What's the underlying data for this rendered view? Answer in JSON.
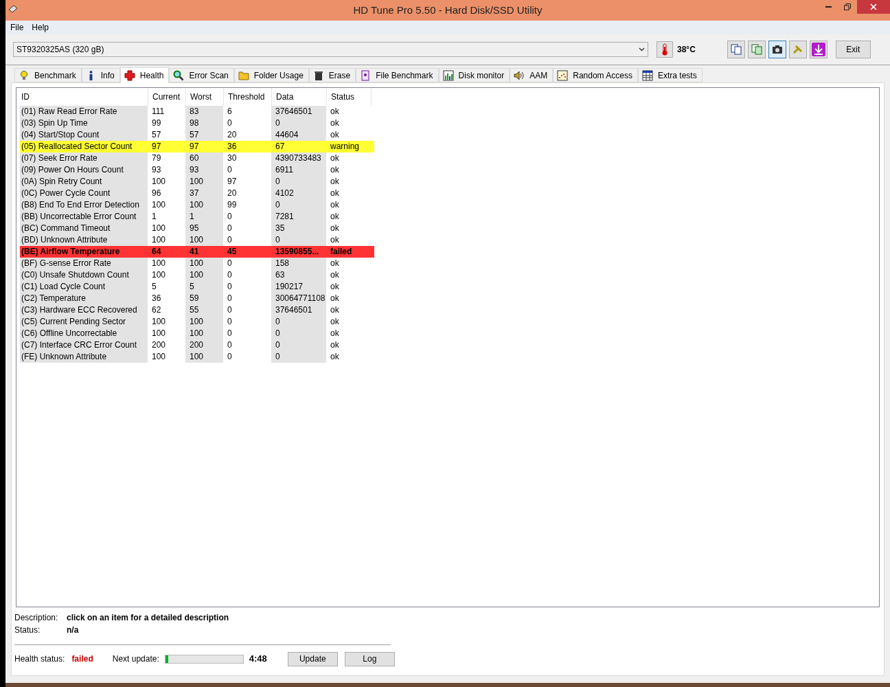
{
  "window": {
    "title": "HD Tune Pro 5.50 - Hard Disk/SSD Utility"
  },
  "menu": [
    "File",
    "Help"
  ],
  "drive_select": {
    "value": "ST9320325AS (320 gB)"
  },
  "temperature": "38°C",
  "toolbar_buttons": [
    {
      "kind": "copy",
      "selected": false
    },
    {
      "kind": "copy-info",
      "selected": false
    },
    {
      "kind": "camera",
      "selected": true
    },
    {
      "kind": "settings",
      "selected": false
    },
    {
      "kind": "save",
      "selected": false
    }
  ],
  "exit_button": "Exit",
  "tabs": [
    {
      "label": "Benchmark",
      "kind": "bulb",
      "selected": false
    },
    {
      "label": "Info",
      "kind": "info",
      "selected": false
    },
    {
      "label": "Health",
      "kind": "cross",
      "selected": true
    },
    {
      "label": "Error Scan",
      "kind": "magnifier",
      "selected": false
    },
    {
      "label": "Folder Usage",
      "kind": "folder",
      "selected": false
    },
    {
      "label": "Erase",
      "kind": "bin",
      "selected": false
    },
    {
      "label": "File Benchmark",
      "kind": "file",
      "selected": false
    },
    {
      "label": "Disk monitor",
      "kind": "chart",
      "selected": false
    },
    {
      "label": "AAM",
      "kind": "speaker",
      "selected": false
    },
    {
      "label": "Random Access",
      "kind": "dots",
      "selected": false
    },
    {
      "label": "Extra tests",
      "kind": "grid",
      "selected": false
    }
  ],
  "table": {
    "columns": [
      "ID",
      "Current",
      "Worst",
      "Threshold",
      "Data",
      "Status"
    ],
    "rows": [
      {
        "cells": [
          "(01) Raw Read Error Rate",
          "111",
          "83",
          "6",
          "37646501",
          "ok"
        ],
        "kind": "ok"
      },
      {
        "cells": [
          "(03) Spin Up Time",
          "99",
          "98",
          "0",
          "0",
          "ok"
        ],
        "kind": "ok"
      },
      {
        "cells": [
          "(04) Start/Stop Count",
          "57",
          "57",
          "20",
          "44604",
          "ok"
        ],
        "kind": "ok"
      },
      {
        "cells": [
          "(05) Reallocated Sector Count",
          "97",
          "97",
          "36",
          "67",
          "warning"
        ],
        "kind": "warning"
      },
      {
        "cells": [
          "(07) Seek Error Rate",
          "79",
          "60",
          "30",
          "4390733483",
          "ok"
        ],
        "kind": "ok"
      },
      {
        "cells": [
          "(09) Power On Hours Count",
          "93",
          "93",
          "0",
          "6911",
          "ok"
        ],
        "kind": "ok"
      },
      {
        "cells": [
          "(0A) Spin Retry Count",
          "100",
          "100",
          "97",
          "0",
          "ok"
        ],
        "kind": "ok"
      },
      {
        "cells": [
          "(0C) Power Cycle Count",
          "96",
          "37",
          "20",
          "4102",
          "ok"
        ],
        "kind": "ok"
      },
      {
        "cells": [
          "(B8) End To End Error Detection",
          "100",
          "100",
          "99",
          "0",
          "ok"
        ],
        "kind": "ok"
      },
      {
        "cells": [
          "(BB) Uncorrectable Error Count",
          "1",
          "1",
          "0",
          "7281",
          "ok"
        ],
        "kind": "ok"
      },
      {
        "cells": [
          "(BC) Command Timeout",
          "100",
          "95",
          "0",
          "35",
          "ok"
        ],
        "kind": "ok"
      },
      {
        "cells": [
          "(BD) Unknown Attribute",
          "100",
          "100",
          "0",
          "0",
          "ok"
        ],
        "kind": "ok"
      },
      {
        "cells": [
          "(BE) Airflow Temperature",
          "64",
          "41",
          "45",
          "13590855...",
          "failed"
        ],
        "kind": "failed"
      },
      {
        "cells": [
          "(BF) G-sense Error Rate",
          "100",
          "100",
          "0",
          "158",
          "ok"
        ],
        "kind": "ok"
      },
      {
        "cells": [
          "(C0) Unsafe Shutdown Count",
          "100",
          "100",
          "0",
          "63",
          "ok"
        ],
        "kind": "ok"
      },
      {
        "cells": [
          "(C1) Load Cycle Count",
          "5",
          "5",
          "0",
          "190217",
          "ok"
        ],
        "kind": "ok"
      },
      {
        "cells": [
          "(C2) Temperature",
          "36",
          "59",
          "0",
          "30064771108",
          "ok"
        ],
        "kind": "ok"
      },
      {
        "cells": [
          "(C3) Hardware ECC Recovered",
          "62",
          "55",
          "0",
          "37646501",
          "ok"
        ],
        "kind": "ok"
      },
      {
        "cells": [
          "(C5) Current Pending Sector",
          "100",
          "100",
          "0",
          "0",
          "ok"
        ],
        "kind": "ok"
      },
      {
        "cells": [
          "(C6) Offline Uncorrectable",
          "100",
          "100",
          "0",
          "0",
          "ok"
        ],
        "kind": "ok"
      },
      {
        "cells": [
          "(C7) Interface CRC Error Count",
          "200",
          "200",
          "0",
          "0",
          "ok"
        ],
        "kind": "ok"
      },
      {
        "cells": [
          "(FE) Unknown Attribute",
          "100",
          "100",
          "0",
          "0",
          "ok"
        ],
        "kind": "ok"
      }
    ]
  },
  "details": [
    {
      "label": "Description:",
      "value": "click on an item for a detailed description"
    },
    {
      "label": "Status:",
      "value": "n/a"
    }
  ],
  "health": {
    "label": "Health status:",
    "value": "failed",
    "next_update_label": "Next update:",
    "level": 0.04,
    "time": "4:48"
  },
  "buttons": [
    "Update",
    "Log"
  ]
}
